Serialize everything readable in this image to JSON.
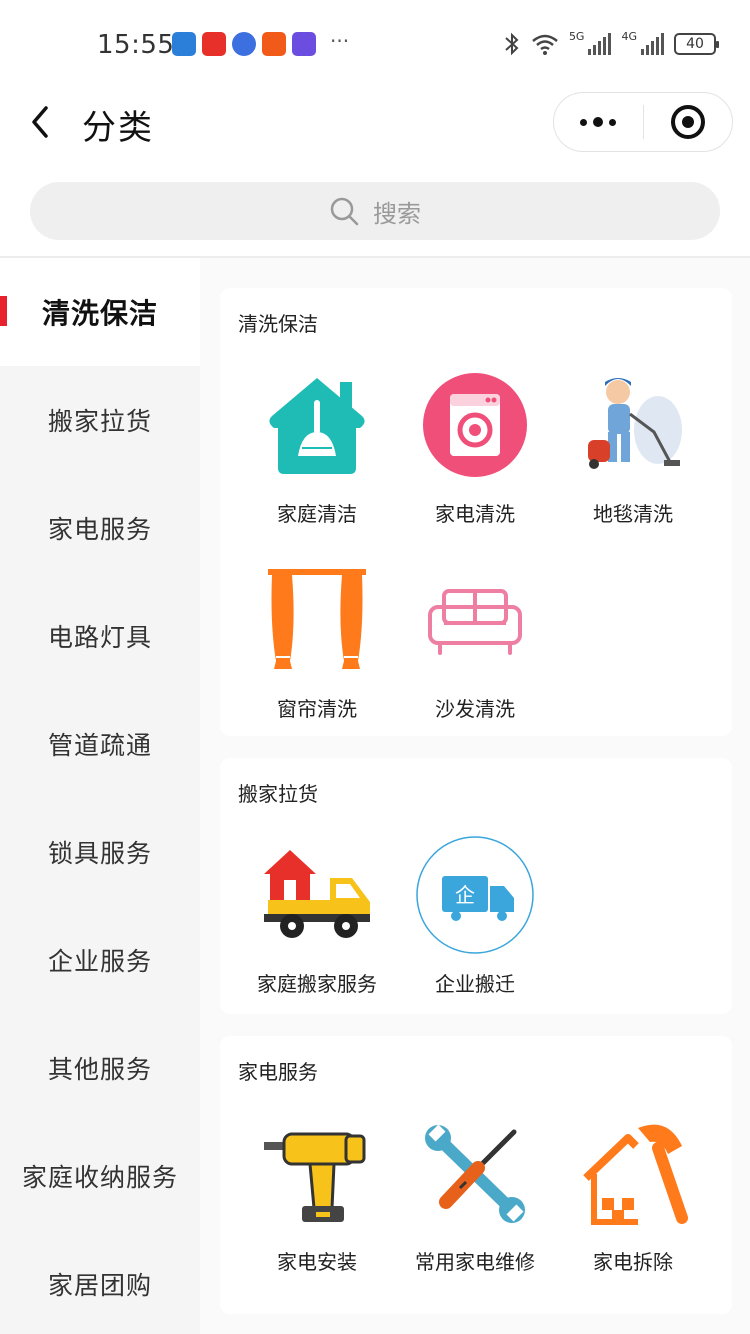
{
  "status_bar": {
    "time": "15:55",
    "net_labels": [
      "5G",
      "4G"
    ],
    "battery": "40",
    "app_colors": [
      "#2b7fd9",
      "#e8302a",
      "#3c6fe0",
      "#f25a1a",
      "#6b4de0"
    ],
    "more": "···"
  },
  "nav": {
    "title": "分类"
  },
  "search": {
    "placeholder": "搜索"
  },
  "sidebar": {
    "items": [
      {
        "label": "清洗保洁",
        "active": true
      },
      {
        "label": "搬家拉货"
      },
      {
        "label": "家电服务"
      },
      {
        "label": "电路灯具"
      },
      {
        "label": "管道疏通"
      },
      {
        "label": "锁具服务"
      },
      {
        "label": "企业服务"
      },
      {
        "label": "其他服务"
      },
      {
        "label": "家庭收纳服务"
      },
      {
        "label": "家居团购"
      }
    ]
  },
  "sections": [
    {
      "title": "清洗保洁",
      "items": [
        {
          "label": "家庭清洁",
          "icon": "house-broom-icon"
        },
        {
          "label": "家电清洗",
          "icon": "washing-machine-icon"
        },
        {
          "label": "地毯清洗",
          "icon": "carpet-cleaner-icon"
        },
        {
          "label": "窗帘清洗",
          "icon": "curtain-icon"
        },
        {
          "label": "沙发清洗",
          "icon": "sofa-icon"
        }
      ]
    },
    {
      "title": "搬家拉货",
      "items": [
        {
          "label": "家庭搬家服务",
          "icon": "moving-truck-icon"
        },
        {
          "label": "企业搬迁",
          "icon": "enterprise-truck-icon",
          "badge": "企"
        }
      ]
    },
    {
      "title": "家电服务",
      "items": [
        {
          "label": "家电安装",
          "icon": "drill-icon"
        },
        {
          "label": "常用家电维修",
          "icon": "wrench-screwdriver-icon"
        },
        {
          "label": "家电拆除",
          "icon": "hammer-house-icon"
        }
      ]
    }
  ],
  "colors": {
    "accent": "#e8212e",
    "teal": "#1fbcb6",
    "pink": "#f04f7a",
    "orange": "#ff7a1a",
    "yellow": "#f7c21a"
  }
}
